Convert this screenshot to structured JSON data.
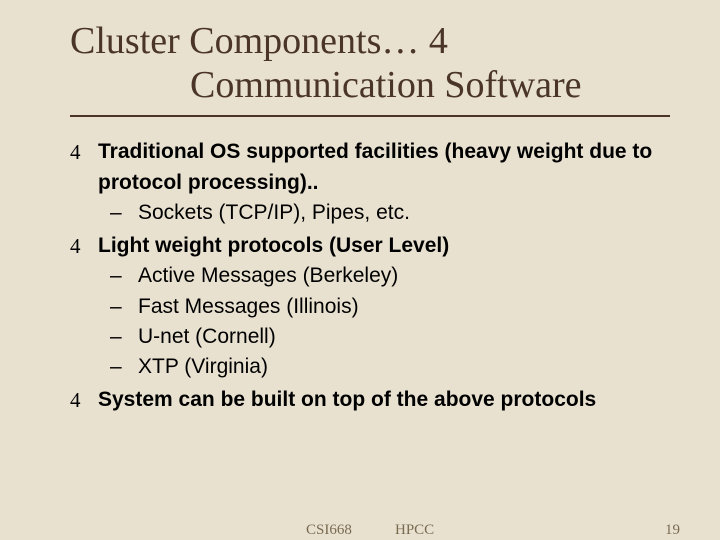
{
  "title": {
    "line1": "Cluster Components… 4",
    "line2": "Communication Software"
  },
  "bullets": {
    "b1": "Traditional OS supported facilities (heavy weight due to protocol processing)..",
    "b1_1": "Sockets (TCP/IP), Pipes, etc.",
    "b2": "Light weight protocols (User Level)",
    "b2_1": "Active Messages (Berkeley)",
    "b2_2": "Fast Messages (Illinois)",
    "b2_3": "U-net (Cornell)",
    "b2_4": "XTP (Virginia)",
    "b3": "System can be built on top of the above protocols"
  },
  "footer": {
    "left": "CSI668",
    "center": "HPCC",
    "right": "19"
  },
  "glyphs": {
    "check": "4",
    "dash": "–"
  }
}
